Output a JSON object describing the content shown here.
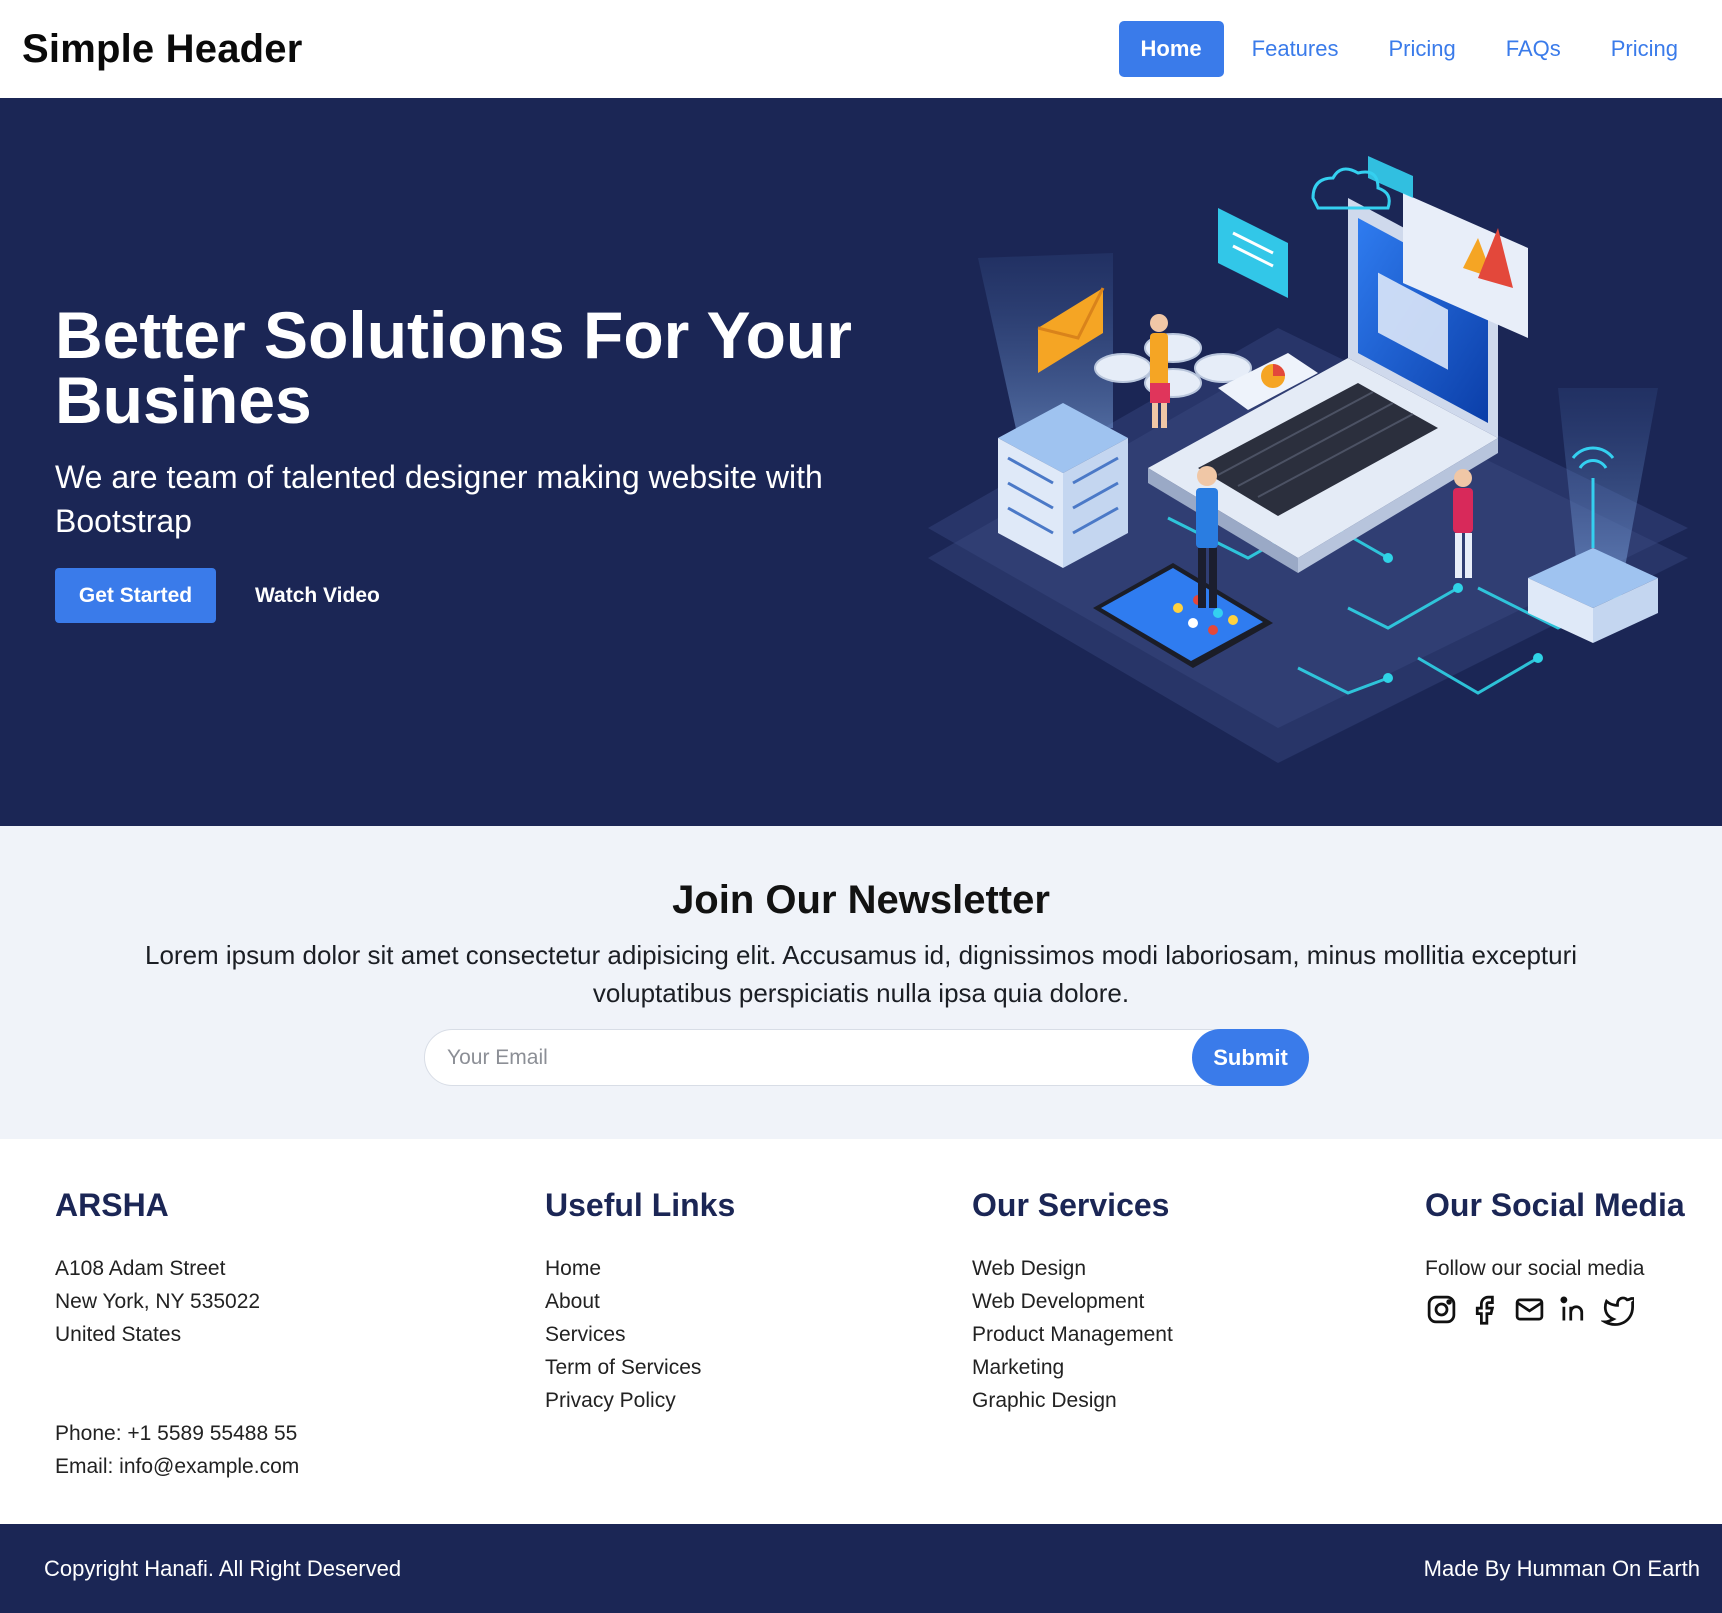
{
  "header": {
    "brand": "Simple Header",
    "nav": [
      {
        "label": "Home",
        "active": true
      },
      {
        "label": "Features",
        "active": false
      },
      {
        "label": "Pricing",
        "active": false
      },
      {
        "label": "FAQs",
        "active": false
      },
      {
        "label": "Pricing",
        "active": false
      }
    ]
  },
  "hero": {
    "title": "Better Solutions For Your Busines",
    "subtitle": "We are team of talented designer making website with Bootstrap",
    "primary_button": "Get Started",
    "secondary_button": "Watch Video",
    "illustration_icon": "isometric-tech-illustration"
  },
  "newsletter": {
    "title": "Join Our Newsletter",
    "text": "Lorem ipsum dolor sit amet consectetur adipisicing elit. Accusamus id, dignissimos modi laboriosam, minus mollitia excepturi voluptatibus perspiciatis nulla ipsa quia dolore.",
    "email_placeholder": "Your Email",
    "email_value": "",
    "submit_label": "Submit"
  },
  "footer": {
    "company": {
      "title": "ARSHA",
      "address_line1": "A108 Adam Street",
      "address_line2": "New York, NY 535022",
      "address_line3": "United States",
      "phone": "Phone: +1 5589 55488 55",
      "email": "Email: info@example.com"
    },
    "useful_links": {
      "title": "Useful Links",
      "items": [
        "Home",
        "About",
        "Services",
        "Term of Services",
        "Privacy Policy"
      ]
    },
    "services": {
      "title": "Our Services",
      "items": [
        "Web Design",
        "Web Development",
        "Product Management",
        "Marketing",
        "Graphic Design"
      ]
    },
    "social": {
      "title": "Our Social Media",
      "text": "Follow our social media",
      "icons": [
        "instagram-icon",
        "facebook-icon",
        "mail-icon",
        "linkedin-icon",
        "twitter-icon"
      ]
    }
  },
  "bottom_bar": {
    "copyright": "Copyright Hanafi. All Right Deserved",
    "credit": "Made By Humman On Earth"
  },
  "colors": {
    "primary": "#3a7bea",
    "navy": "#1b2655",
    "newsletter_bg": "#f0f3f9"
  }
}
